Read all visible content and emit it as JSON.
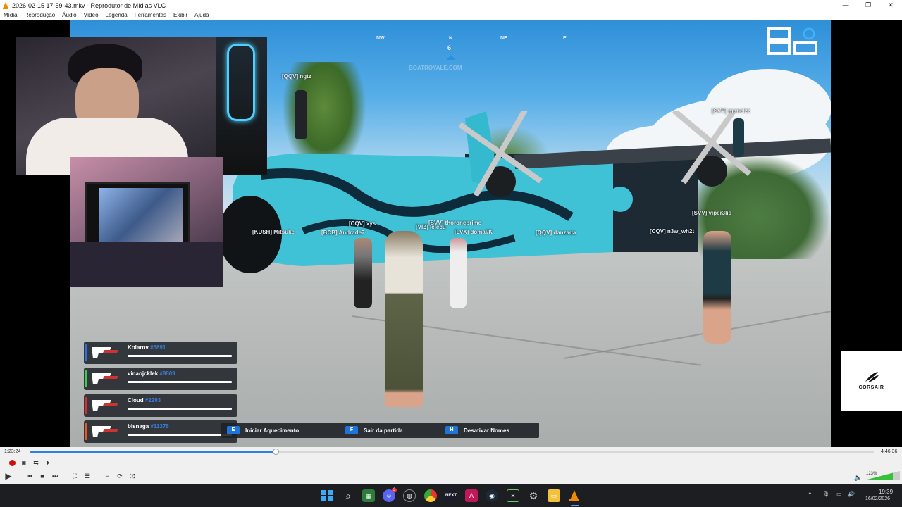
{
  "window": {
    "title": "2026-02-15 17-59-43.mkv - Reprodutor de Mídias VLC",
    "menu": [
      "Mídia",
      "Reprodução",
      "Áudio",
      "Vídeo",
      "Legenda",
      "Ferramentas",
      "Exibir",
      "Ajuda"
    ]
  },
  "game": {
    "compass": {
      "nw": "NW",
      "n": "N",
      "ne": "NE",
      "e": "E",
      "heading": "6"
    },
    "watermark": "BOATROYALE.COM",
    "nametags": [
      "[QQV] ngtz",
      "[SVV] manelzz",
      "[SVV] thoroneprime",
      "[CQV] xys",
      "[KUSH] Mitsuke",
      "[BCB] Andrade7",
      "[VIZ] lelecu",
      "[LVX] domal/K",
      "[QQV] danzada",
      "[SVV] viper3lis",
      "[CQV] n3w_wh2t"
    ],
    "players": [
      {
        "name": "Kolarov",
        "id": "#6891",
        "color": "#2f6fe0"
      },
      {
        "name": "vinaojcklek",
        "id": "#9809",
        "color": "#39d14a"
      },
      {
        "name": "Cloud",
        "id": "#2293",
        "color": "#e02a2a"
      },
      {
        "name": "bisnaga",
        "id": "#11378",
        "color": "#f0561f"
      }
    ],
    "hints": [
      {
        "key": "E",
        "label": "Iniciar Aquecimento"
      },
      {
        "key": "F",
        "label": "Sair da partida"
      },
      {
        "key": "H",
        "label": "Desativar Nomes"
      }
    ],
    "sponsor": "CORSAIR"
  },
  "player": {
    "elapsed": "1:23:24",
    "total": "4:46:36",
    "progress": 0.291,
    "volume": "123%"
  },
  "taskbar": {
    "time": "19:39",
    "date": "16/02/2026",
    "discord_badge": "3"
  }
}
